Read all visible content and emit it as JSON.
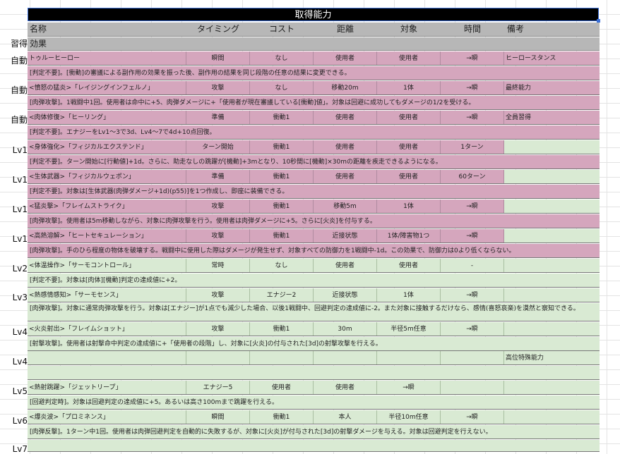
{
  "sheet": {
    "title": "取得能力",
    "header1": [
      "名称",
      "タイミング",
      "コスト",
      "距離",
      "対象",
      "時間",
      "備考"
    ],
    "header2": {
      "learn": "習得",
      "effect": "効果"
    }
  },
  "levels": [
    "自動",
    "自動",
    "自動",
    "Lv1",
    "Lv1",
    "Lv1",
    "Lv1",
    "Lv2",
    "Lv3",
    "Lv4",
    "Lv4",
    "Lv5",
    "Lv6",
    "Lv7"
  ],
  "skills": [
    {
      "name": "トゥルーヒーロー",
      "timing": "瞬間",
      "cost": "なし",
      "range": "使用者",
      "target": "使用者",
      "time": "→瞬",
      "note": "ヒーロースタンス",
      "effect": "[判定不要]。[衝動]の審議による副作用の効果を振った後、副作用の結果を同じ段階の任意の結果に変更できる。"
    },
    {
      "name": "<憤怒の猛炎>「レイジングインフェルノ」",
      "timing": "攻撃",
      "cost": "なし",
      "range": "移動20m",
      "target": "1体",
      "time": "→瞬",
      "note": "最終能力",
      "effect": "[肉弾攻撃]。1戦闘中1回。使用者は命中に+5、肉弾ダメージに+「使用者が現在審議している[衝動]値」。対象は回避に成功してもダメージの1/2を受ける。"
    },
    {
      "name": "<肉体修復>「ヒーリング」",
      "timing": "準備",
      "cost": "衝動1",
      "range": "使用者",
      "target": "使用者",
      "time": "→瞬",
      "note": "全員習得",
      "effect": "[判定不要]。エナジーをLv1～3で3d、Lv4～7で4d+10点回復。"
    },
    {
      "name": "<身体強化>「フィジカルエクステンド」",
      "timing": "ターン開始",
      "cost": "衝動1",
      "range": "使用者",
      "target": "使用者",
      "time": "1ターン",
      "note": "",
      "effect": "[判定不要]。ターン開始に[行動値]+1d。さらに、助走なしの跳躍が[機動]+3mとなり、10秒間に[機動]×30mの距離を疾走できるようになる。"
    },
    {
      "name": "<生体武器>「フィジカルウェポン」",
      "timing": "準備",
      "cost": "衝動1",
      "range": "使用者",
      "target": "使用者",
      "time": "60ターン",
      "note": "",
      "effect": "[判定不要]。対象は[生体武器(肉弾ダメージ+1d)(p55)]を1つ作成し、即座に装備できる。"
    },
    {
      "name": "<猛炎撃>「フレイムストライク」",
      "timing": "攻撃",
      "cost": "衝動1",
      "range": "移動5m",
      "target": "1体",
      "time": "→瞬",
      "note": "",
      "effect": "[肉弾攻撃]。使用者は5m移動しながら、対象に肉弾攻撃を行う。使用者は肉弾ダメージに+5。さらに[火炎]を付与する。"
    },
    {
      "name": "<高熱溶解>「ヒートセキュレーション」",
      "timing": "攻撃",
      "cost": "衝動1",
      "range": "近接状態",
      "target": "1体/障害物1つ",
      "time": "→瞬",
      "note": "",
      "effect": "[肉弾攻撃]。手のひら程度の物体を破壊する。戦闘中に使用した際はダメージが発生せず、対象すべての防御力を1戦闘中-1d。この効果で、防御力は0より低くならない。"
    },
    {
      "name": "<体温操作>「サーモコントロール」",
      "timing": "常時",
      "cost": "なし",
      "range": "使用者",
      "target": "使用者",
      "time": "-",
      "note": "",
      "effect": "[判定不要]。対象は[肉体][機動]判定の達成値に+2。"
    },
    {
      "name": "<熱感情感知>「サーモセンス」",
      "timing": "攻撃",
      "cost": "エナジー2",
      "range": "近接状態",
      "target": "1体",
      "time": "→瞬",
      "note": "",
      "effect": "[肉弾攻撃]。対象に通常肉弾攻撃を行う。対象は[エナジー]が1点でも減少した場合、以後1戦闘中、回避判定の達成値に-2。また対象に接触するだけなら、感情(喜怒哀楽)を漠然と察知できる。"
    },
    {
      "name": "<火炎射出>「フレイムショット」",
      "timing": "攻撃",
      "cost": "衝動1",
      "range": "30m",
      "target": "半径5m任意",
      "time": "→瞬",
      "note": "",
      "effect": "[射撃攻撃]。使用者は射撃命中判定の達成値に+「使用者の段階」し、対象に[火炎]の付与された[3d]の射撃攻撃を行える。"
    },
    {
      "name": "",
      "timing": "",
      "cost": "",
      "range": "",
      "target": "",
      "time": "",
      "note": "高位特殊能力",
      "effect": ""
    },
    {
      "name": "<熱射跳躍>「ジェットリープ」",
      "timing": "エナジー5",
      "cost": "使用者",
      "range": "使用者",
      "target": "→瞬",
      "time": "",
      "note": "",
      "effect": "[回避判定時]。対象は回避判定の達成値に+5。あるいは高さ100mまで跳躍を行える。"
    },
    {
      "name": "<爆炎波>「プロミネンス」",
      "timing": "瞬間",
      "cost": "衝動1",
      "range": "本人",
      "target": "半径10m任意",
      "time": "→瞬",
      "note": "",
      "effect": "[肉弾反撃]。1ターン中1回。使用者は肉弾回避判定を自動的に失敗するが、対象に[火炎]が付与された[3d]の射撃ダメージを与える。対象は回避判定を行えない。"
    }
  ]
}
